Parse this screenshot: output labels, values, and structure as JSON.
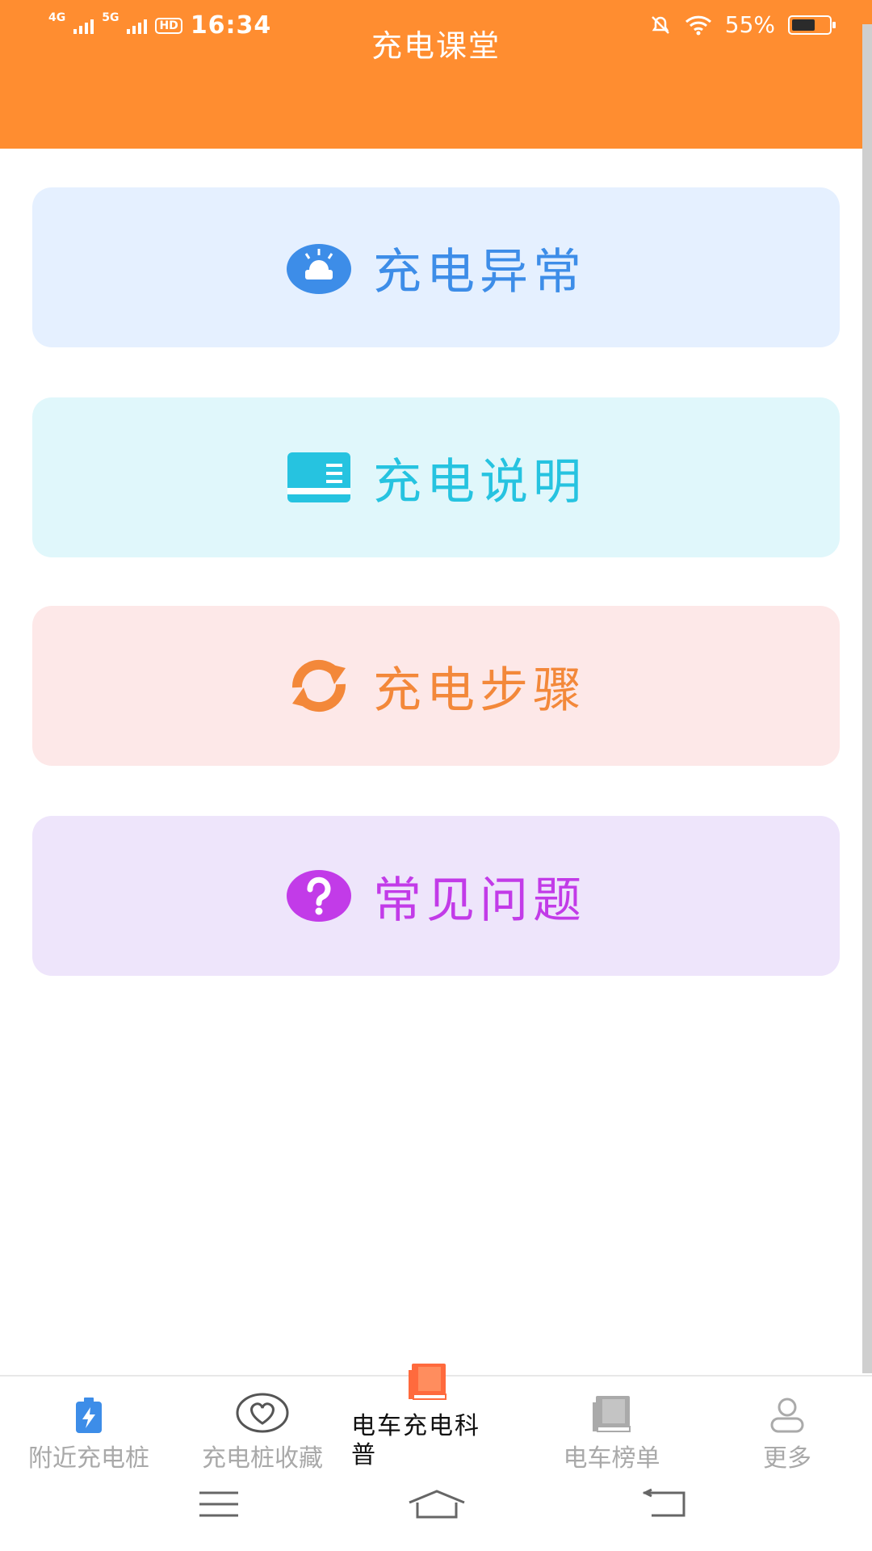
{
  "status_bar": {
    "net1": "4G",
    "net2": "5G",
    "hd": "HD",
    "time": "16:34",
    "battery": "55%"
  },
  "header": {
    "title": "充电课堂"
  },
  "menu": [
    {
      "label": "充电异常",
      "icon": "alarm-light-icon",
      "color": "#3D8DE8"
    },
    {
      "label": "充电说明",
      "icon": "book-icon",
      "color": "#26C3E0"
    },
    {
      "label": "充电步骤",
      "icon": "refresh-icon",
      "color": "#F3883A"
    },
    {
      "label": "常见问题",
      "icon": "question-icon",
      "color": "#C23BE8"
    }
  ],
  "tabs": [
    {
      "label": "附近充电桩",
      "icon": "charging-pile-icon"
    },
    {
      "label": "充电桩收藏",
      "icon": "heart-icon"
    },
    {
      "label": "电车充电科普",
      "icon": "book-icon",
      "active": true
    },
    {
      "label": "电车榜单",
      "icon": "list-book-icon"
    },
    {
      "label": "更多",
      "icon": "user-icon"
    }
  ],
  "colors": {
    "accent": "#FF8D30",
    "active_tab_icon": "#FF6A3D"
  }
}
